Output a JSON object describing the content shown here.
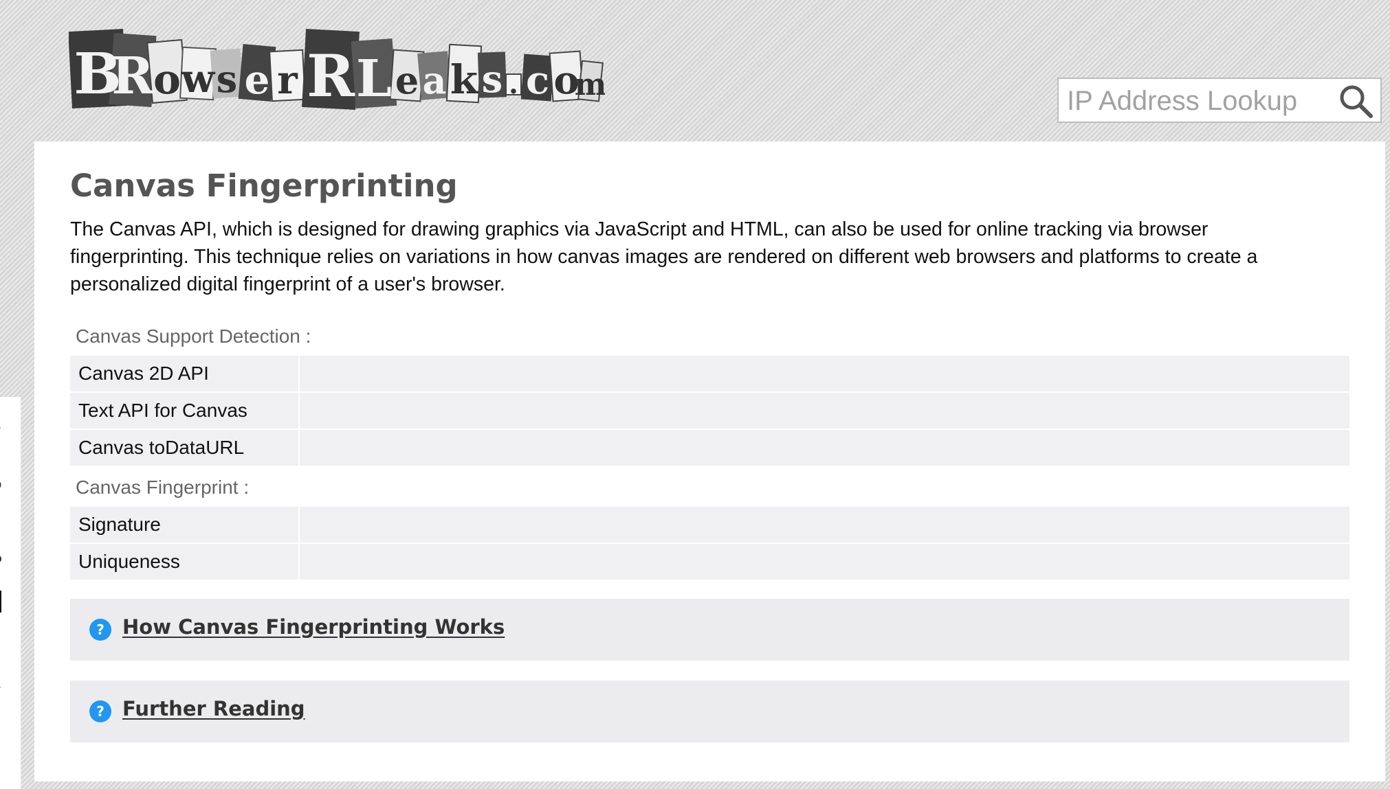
{
  "header": {
    "logo_text": "BrowserLeaks.com",
    "search": {
      "placeholder": "IP Address Lookup",
      "value": ""
    }
  },
  "main": {
    "title": "Canvas Fingerprinting",
    "intro": "The Canvas API, which is designed for drawing graphics via JavaScript and HTML, can also be used for online tracking via browser fingerprinting. This technique relies on variations in how canvas images are rendered on different web browsers and platforms to create a personalized digital fingerprint of a user's browser.",
    "support_section": {
      "label": "Canvas Support Detection :",
      "rows": [
        {
          "key": "Canvas 2D API",
          "value": ""
        },
        {
          "key": "Text API for Canvas",
          "value": ""
        },
        {
          "key": "Canvas toDataURL",
          "value": ""
        }
      ]
    },
    "fingerprint_section": {
      "label": "Canvas Fingerprint :",
      "rows": [
        {
          "key": "Signature",
          "value": ""
        },
        {
          "key": "Uniqueness",
          "value": ""
        }
      ]
    },
    "accordions": [
      {
        "label": "How Canvas Fingerprinting Works"
      },
      {
        "label": "Further Reading"
      }
    ]
  },
  "colors": {
    "accent_blue": "#2196f3",
    "title_gray": "#555555",
    "row_bg": "#f0f0f2"
  }
}
